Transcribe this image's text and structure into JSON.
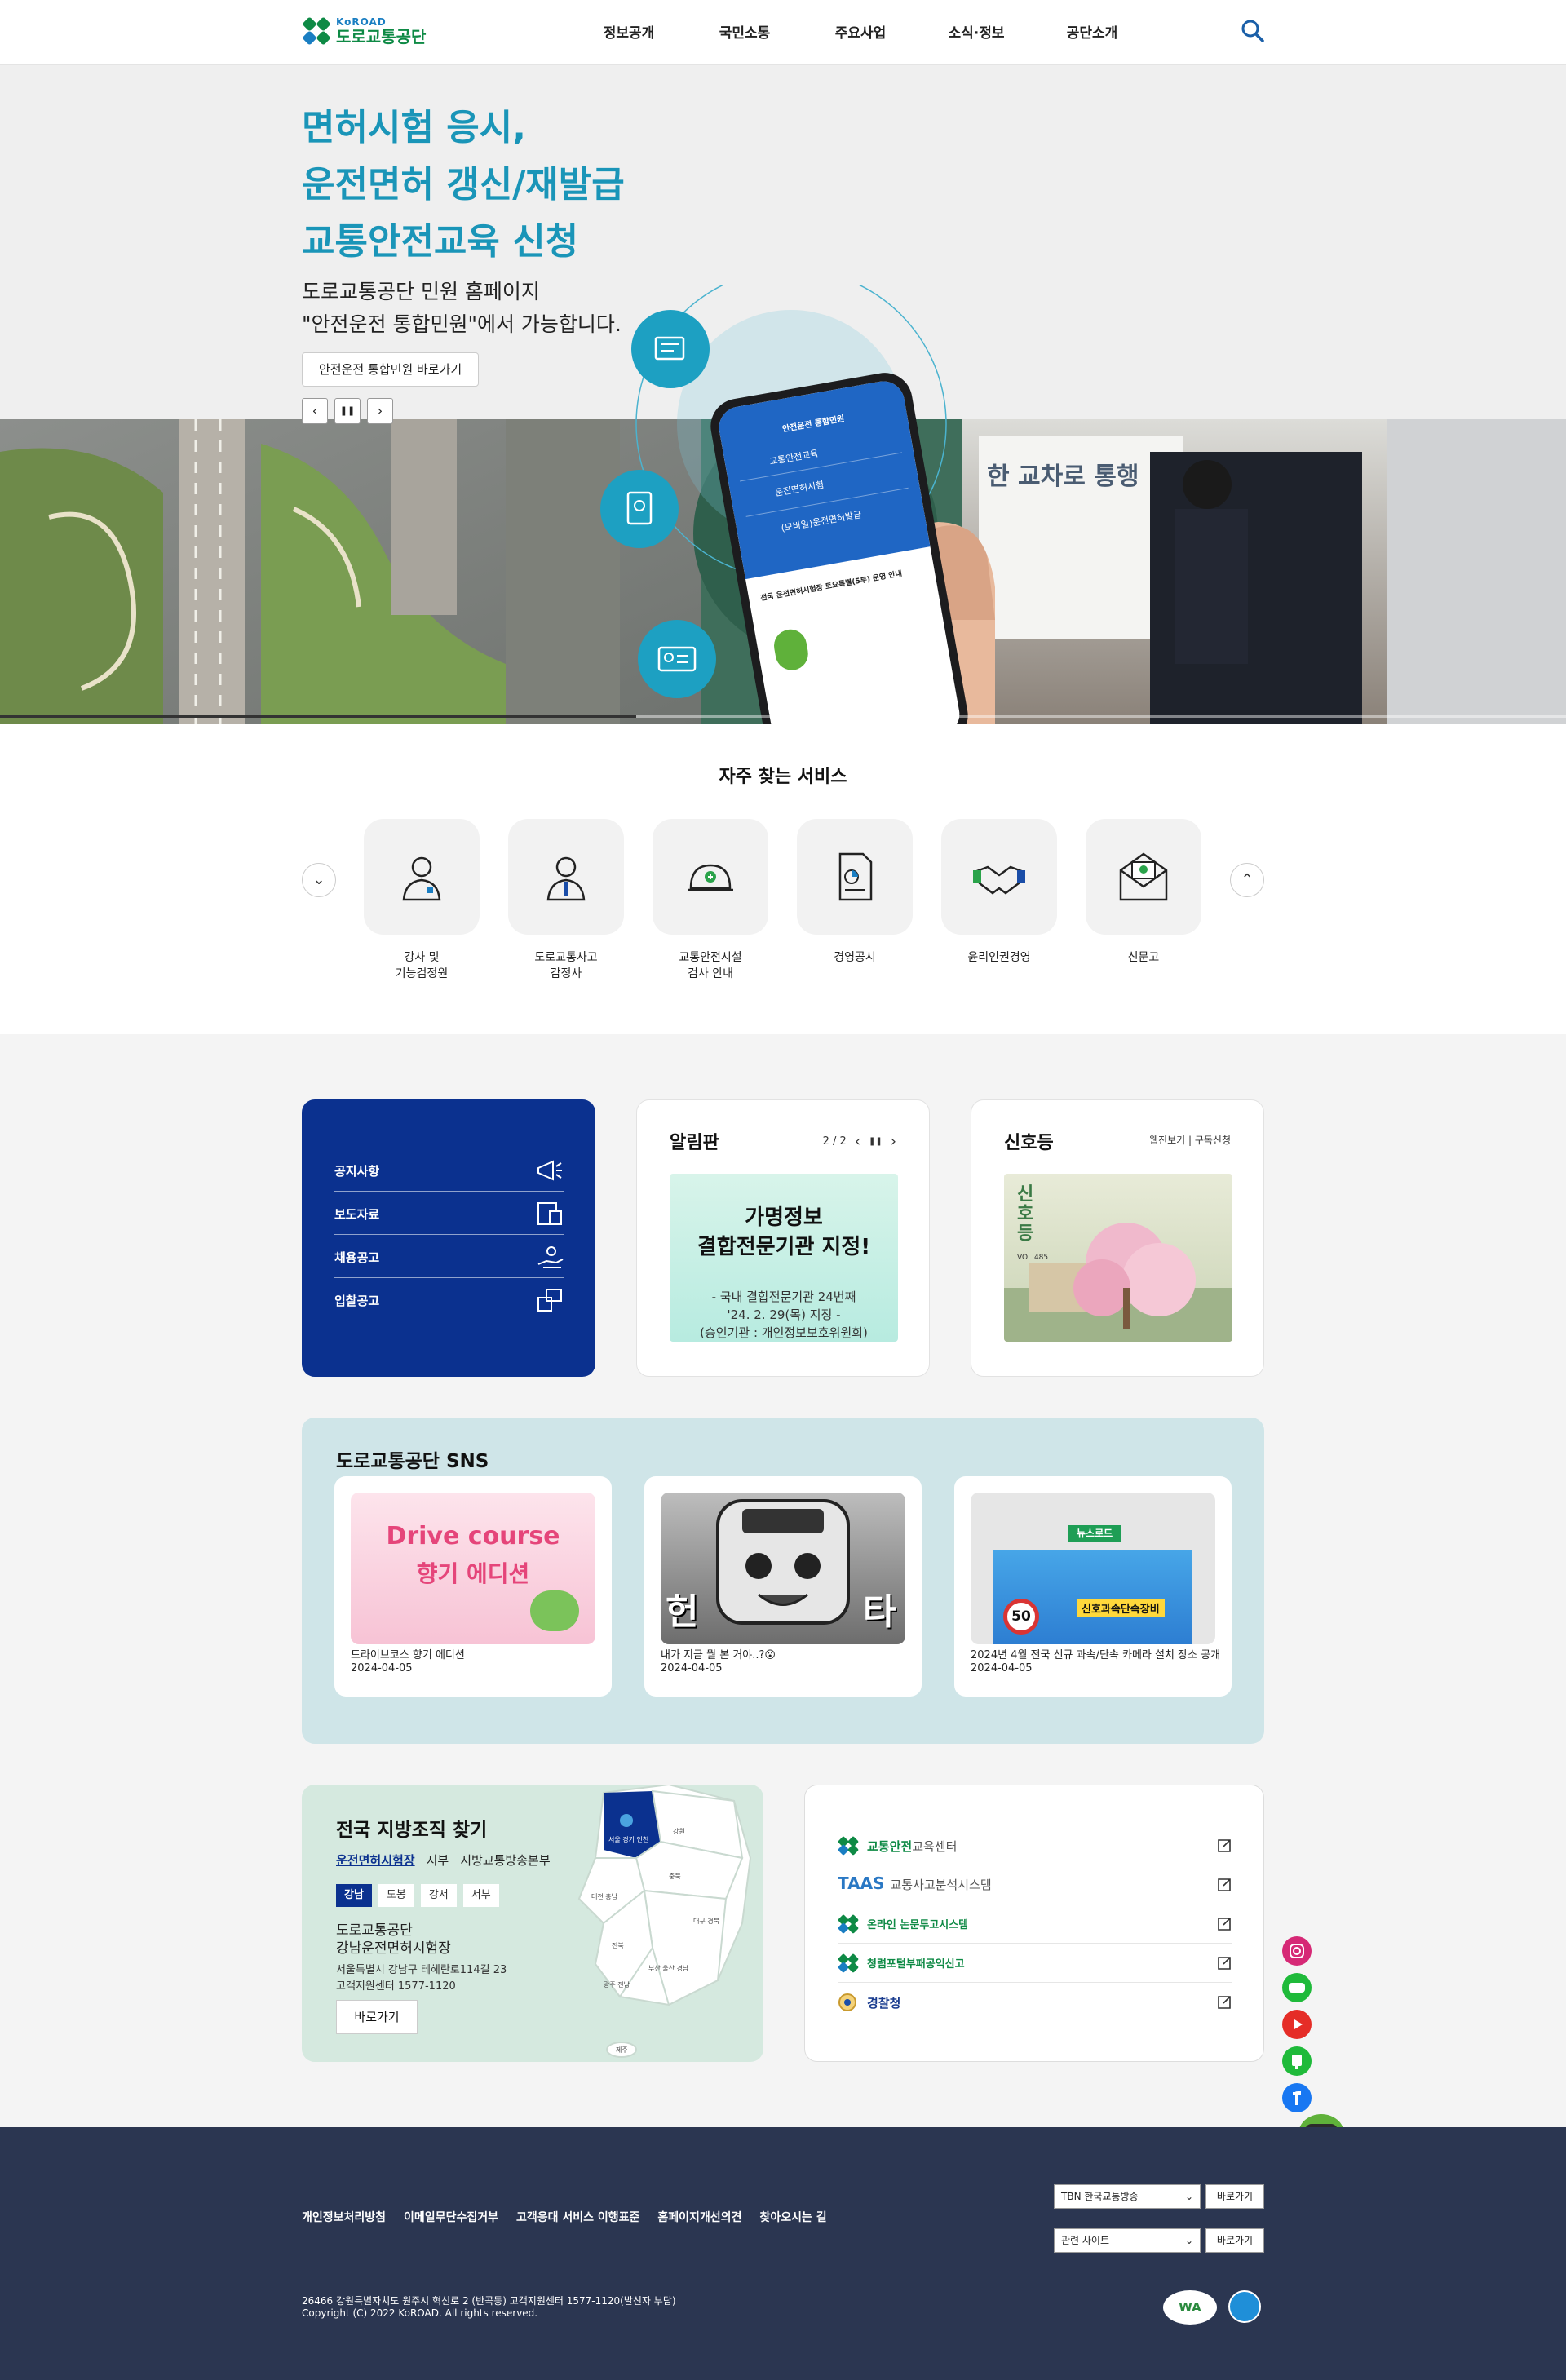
{
  "header": {
    "logo_en": "KoROAD",
    "logo_ko": "도로교통공단",
    "nav": [
      "정보공개",
      "국민소통",
      "주요사업",
      "소식·정보",
      "공단소개"
    ]
  },
  "hero": {
    "title_lines": [
      "면허시험 응시,",
      "운전면허 갱신/재발급",
      "교통안전교육 신청"
    ],
    "desc_lines": [
      "도로교통공단 민원 홈페이지",
      "\"안전운전 통합민원\"에서 가능합니다."
    ],
    "link_label": "안전운전 통합민원 바로가기",
    "prev": "‹",
    "pause": "❚❚",
    "next": "›",
    "phone_header": "안전운전 통합민원",
    "phone_menu": [
      "교통안전교육",
      "운전면허시험",
      "(모바일)운전면허발급"
    ],
    "phone_notice": "전국 운전면허시험장 토요특별(5부) 운영 안내",
    "banner_sign": "한 교차로 통행"
  },
  "services": {
    "title": "자주 찾는 서비스",
    "items": [
      {
        "label_1": "강사 및",
        "label_2": "기능검정원"
      },
      {
        "label_1": "도로교통사고",
        "label_2": "감정사"
      },
      {
        "label_1": "교통안전시설",
        "label_2": "검사 안내"
      },
      {
        "label_1": "경영공시",
        "label_2": ""
      },
      {
        "label_1": "윤리인권경영",
        "label_2": ""
      },
      {
        "label_1": "신문고",
        "label_2": ""
      }
    ]
  },
  "board": {
    "menu": [
      "공지사항",
      "보도자료",
      "채용공고",
      "입찰공고"
    ],
    "alarm": {
      "title": "알림판",
      "page": "2 / 2",
      "image_title_1": "가명정보",
      "image_title_2": "결합전문기관 지정!",
      "image_sub_1": "- 국내 결합전문기관 24번째",
      "image_sub_2": "'24. 2. 29(목) 지정 -",
      "image_sub_3": "(승인기관 : 개인정보보호위원회)"
    },
    "signal": {
      "title": "신호등",
      "links": "웹진보기 | 구독신청",
      "cover_title": "신호등",
      "cover_issue": "VOL.485"
    }
  },
  "sns": {
    "title": "도로교통공단 SNS",
    "posts": [
      {
        "caption": "드라이브코스 향기 에디션",
        "date": "2024-04-05",
        "thumb_1": "Drive course",
        "thumb_2": "향기 에디션"
      },
      {
        "caption": "내가 지금 뭘 본 거야..?😮",
        "date": "2024-04-05",
        "thumb_1": "헌",
        "thumb_2": "타"
      },
      {
        "caption": "2024년 4월 전국 신규 과속/단속 카메라 설치 장소 공개",
        "date": "2024-04-05",
        "thumb_1": "뉴스로드",
        "thumb_2": "신호과속단속장비",
        "speed": "50"
      }
    ]
  },
  "region": {
    "title": "전국 지방조직 찾기",
    "tabs": [
      "운전면허시험장",
      "지부",
      "지방교통방송본부"
    ],
    "pills": [
      "강남",
      "도봉",
      "강서",
      "서부"
    ],
    "name_1": "도로교통공단",
    "name_2": "강남운전면허시험장",
    "addr_1": "서울특별시 강남구 테헤란로114길 23",
    "addr_2": "고객지원센터 1577-1120",
    "go": "바로가기",
    "map_labels": [
      "서울 경기 인천",
      "강원",
      "충북",
      "대전 충남",
      "대구 경북",
      "전북",
      "부산 울산 경남",
      "광주 전남",
      "제주"
    ]
  },
  "links": [
    {
      "main": "교통안전",
      "sub": "교육센터"
    },
    {
      "main": "TAAS",
      "sub": "교통사고분석시스템"
    },
    {
      "main": "온라인 논문투고시스템",
      "sub": ""
    },
    {
      "main": "청렴포털부패공익신고",
      "sub": ""
    },
    {
      "main": "경찰청",
      "sub": ""
    }
  ],
  "footer": {
    "links": [
      "개인정보처리방침",
      "이메일무단수집거부",
      "고객응대 서비스 이행표준",
      "홈페이지개선의견",
      "찾아오시는 길"
    ],
    "select_1": "TBN 한국교통방송",
    "select_2": "관련 사이트",
    "go_1": "바로가기",
    "go_2": "바로가기",
    "addr": "26466 강원특별자치도 원주시 혁신로 2 (반곡동) 고객지원센터 1577-1120(발신자 부담)",
    "copyright": "Copyright (C) 2022 KoROAD. All rights reserved.",
    "badge_1": "WA"
  },
  "colors": {
    "brand_green": "#0e8a45",
    "hero_title": "#1a95b8",
    "navy": "#0b318f",
    "footer": "#2b3651"
  }
}
